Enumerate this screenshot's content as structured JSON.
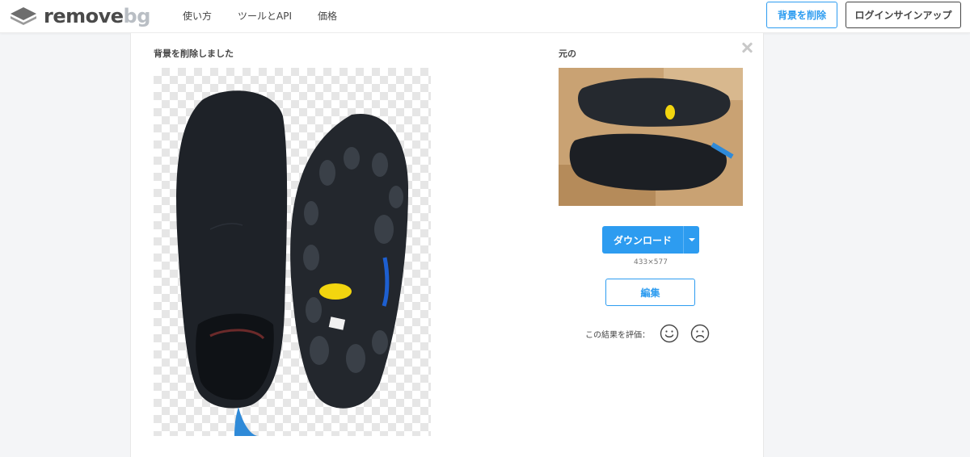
{
  "header": {
    "logo_main": "remove",
    "logo_accent": "bg",
    "nav": [
      "使い方",
      "ツールとAPI",
      "価格"
    ],
    "remove_bg_button": "背景を削除",
    "login_button": "ログインサインアップ"
  },
  "panel": {
    "removed_label": "背景を削除しました",
    "original_label": "元の",
    "download_label": "ダウンロード",
    "dimensions": "433×577",
    "edit_label": "編集",
    "rate_label": "この結果を評価："
  },
  "icons": {
    "logo": "remove-bg-logo-icon",
    "close": "close-icon",
    "dropdown": "chevron-down-icon",
    "happy": "smiley-face-icon",
    "sad": "frowning-face-icon"
  },
  "colors": {
    "accent": "#2d9cf0",
    "text": "#454545",
    "page_bg": "#f4f5f7"
  }
}
